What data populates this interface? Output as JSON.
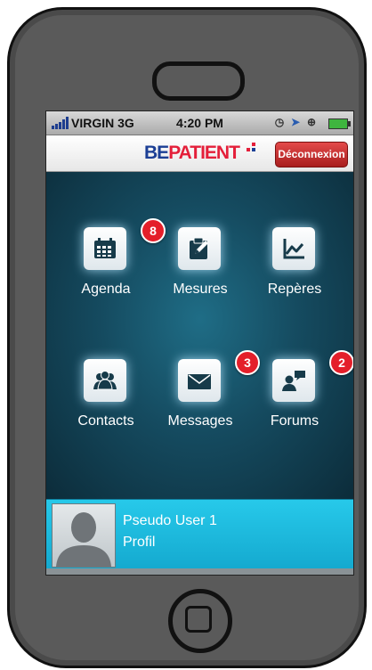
{
  "status_bar": {
    "carrier": "VIRGIN 3G",
    "time": "4:20 PM",
    "icons": [
      "clock-icon",
      "location-arrow-icon",
      "rotation-lock-icon",
      "battery-icon"
    ]
  },
  "nav": {
    "logo_part1": "BE",
    "logo_part2": "PATIENT",
    "logout_label": "Déconnexion"
  },
  "tiles": [
    {
      "label": "Agenda",
      "icon": "calendar-icon",
      "badge": "8"
    },
    {
      "label": "Mesures",
      "icon": "clipboard-edit-icon",
      "badge": ""
    },
    {
      "label": "Repères",
      "icon": "line-chart-icon",
      "badge": ""
    },
    {
      "label": "Contacts",
      "icon": "people-icon",
      "badge": ""
    },
    {
      "label": "Messages",
      "icon": "envelope-icon",
      "badge": "3"
    },
    {
      "label": "Forums",
      "icon": "chat-user-icon",
      "badge": "2"
    }
  ],
  "profile": {
    "name": "Pseudo User 1",
    "link_label": "Profil"
  },
  "colors": {
    "brand_blue": "#1c3f95",
    "brand_red": "#e41f3a",
    "badge_red": "#e41f2a",
    "profile_bar": "#1bb8dc",
    "background_teal": "#154b60"
  }
}
